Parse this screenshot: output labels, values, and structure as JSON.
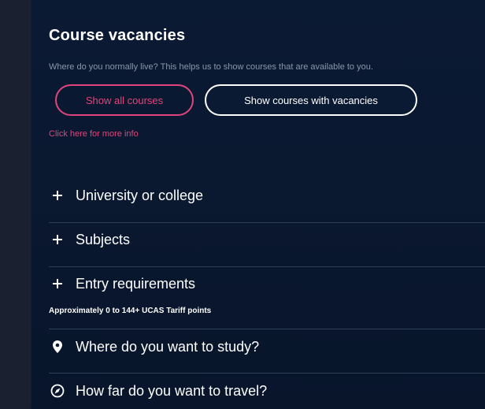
{
  "header": {
    "title": "Course vacancies",
    "subtitle": "Where do you normally live? This helps us to show courses that are available to you."
  },
  "buttons": {
    "show_all": "Show all courses",
    "show_vacancies": "Show courses with vacancies"
  },
  "more_info": "Click here for more info",
  "filters": [
    {
      "label": "University or college",
      "icon": "plus-icon"
    },
    {
      "label": "Subjects",
      "icon": "plus-icon"
    },
    {
      "label": "Entry requirements",
      "icon": "plus-icon",
      "note": "Approximately 0 to 144+ UCAS Tariff points"
    },
    {
      "label": "Where do you want to study?",
      "icon": "location-pin-icon"
    },
    {
      "label": "How far do you want to travel?",
      "icon": "compass-icon"
    }
  ],
  "colors": {
    "panel_bg": "#0b1a33",
    "accent_pink": "#e0457b",
    "text_white": "#ffffff",
    "text_muted": "#8a96aa",
    "divider": "#2f3d55"
  }
}
